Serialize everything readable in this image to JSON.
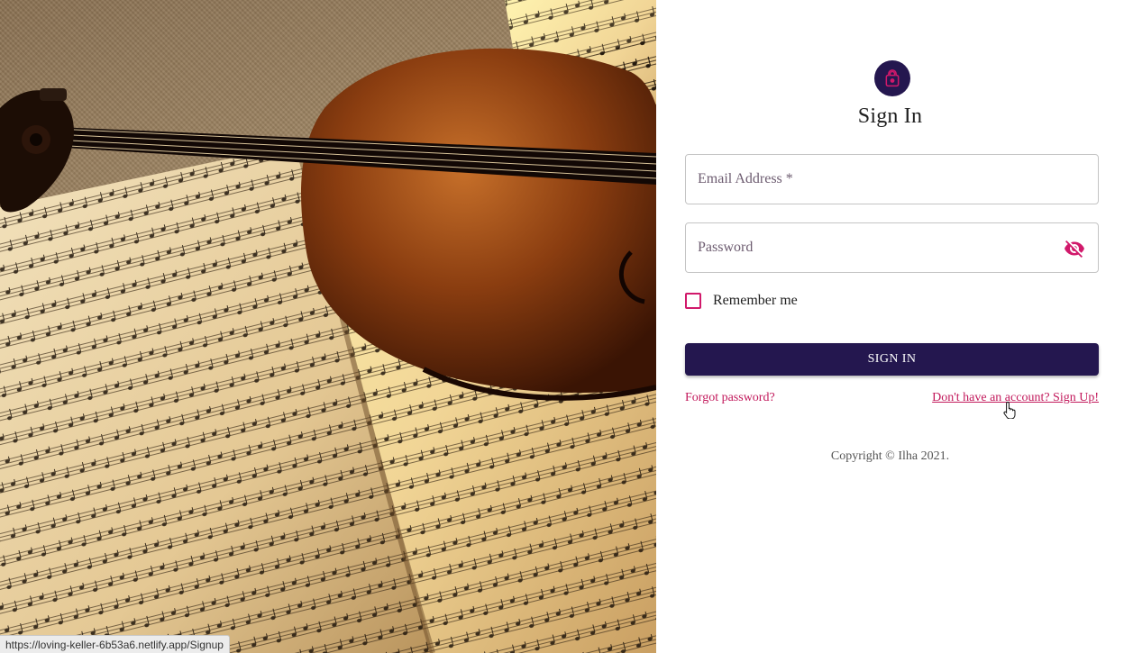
{
  "hero": {
    "image_icon": "violin-sheet-music-photo"
  },
  "signin": {
    "avatar_icon": "lock-icon",
    "title": "Sign In",
    "email_placeholder": "Email Address *",
    "password_placeholder": "Password",
    "password_toggle_icon": "eye-off-icon",
    "remember_label": "Remember me",
    "remember_checked": false,
    "submit_label": "SIGN IN",
    "forgot_link": "Forgot password?",
    "signup_link": "Don't have an account? Sign Up!",
    "copyright": "Copyright © Ilha 2021."
  },
  "statusbar": {
    "url": "https://loving-keller-6b53a6.netlify.app/Signup"
  },
  "colors": {
    "primary": "#24174f",
    "accent": "#d1196b",
    "link": "#c2185b"
  }
}
